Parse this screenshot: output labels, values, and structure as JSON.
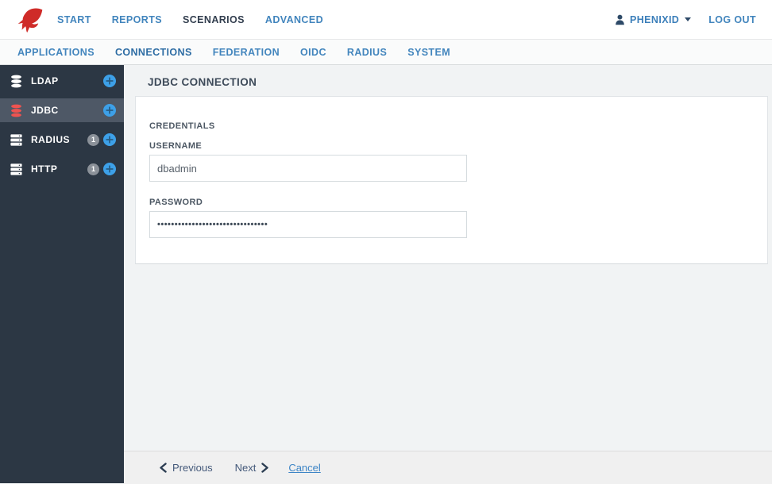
{
  "brand": {
    "logo_icon": "phoenix-logo"
  },
  "topnav": {
    "items": [
      {
        "label": "START",
        "active": false
      },
      {
        "label": "REPORTS",
        "active": false
      },
      {
        "label": "SCENARIOS",
        "active": true
      },
      {
        "label": "ADVANCED",
        "active": false
      }
    ],
    "user": {
      "icon": "user-icon",
      "name": "PHENIXID",
      "caret": "caret-down-icon"
    },
    "logout_label": "LOG OUT"
  },
  "subnav": {
    "items": [
      {
        "label": "APPLICATIONS",
        "active": false
      },
      {
        "label": "CONNECTIONS",
        "active": true
      },
      {
        "label": "FEDERATION",
        "active": false
      },
      {
        "label": "OIDC",
        "active": false
      },
      {
        "label": "RADIUS",
        "active": false
      },
      {
        "label": "SYSTEM",
        "active": false
      }
    ]
  },
  "sidebar": {
    "items": [
      {
        "label": "LDAP",
        "icon": "database-icon",
        "count": "",
        "selected": false
      },
      {
        "label": "JDBC",
        "icon": "database-icon",
        "count": "",
        "selected": true
      },
      {
        "label": "RADIUS",
        "icon": "server-icon",
        "count": "1",
        "selected": false
      },
      {
        "label": "HTTP",
        "icon": "server-icon",
        "count": "1",
        "selected": false
      }
    ],
    "add_icon": "plus-circle-icon"
  },
  "main": {
    "title": "JDBC CONNECTION",
    "panel": {
      "section_title": "CREDENTIALS",
      "fields": [
        {
          "label": "USERNAME",
          "value": "dbadmin"
        },
        {
          "label": "PASSWORD",
          "value": "••••••••••••••••••••••••••••••••"
        }
      ]
    }
  },
  "footer": {
    "previous_label": "Previous",
    "next_label": "Next",
    "cancel_label": "Cancel",
    "chevron_left": "chevron-left-icon",
    "chevron_right": "chevron-right-icon"
  },
  "colors": {
    "link_blue": "#3d85c6",
    "active_dark": "#333f4f",
    "sidebar_bg": "#2c3744",
    "sidebar_selected_bg": "#4e5866",
    "logo_red": "#cf2b28",
    "jdbc_icon_red": "#ef5350",
    "plus_circle_blue": "#3da0e8",
    "badge_gray": "#8b9199",
    "main_bg": "#f1f3f4"
  }
}
